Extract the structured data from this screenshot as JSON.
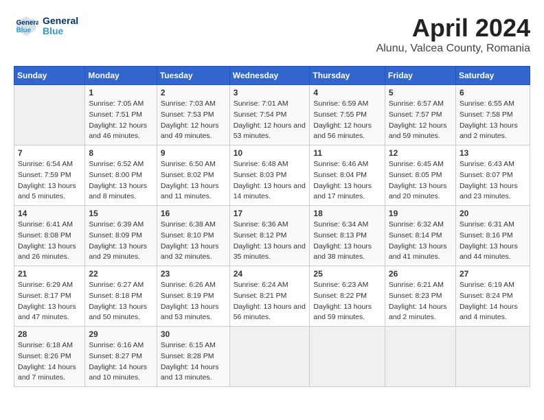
{
  "header": {
    "logo_line1": "General",
    "logo_line2": "Blue",
    "title": "April 2024",
    "subtitle": "Alunu, Valcea County, Romania"
  },
  "calendar": {
    "days_of_week": [
      "Sunday",
      "Monday",
      "Tuesday",
      "Wednesday",
      "Thursday",
      "Friday",
      "Saturday"
    ],
    "weeks": [
      [
        {
          "day": "",
          "empty": true
        },
        {
          "day": "1",
          "sunrise": "Sunrise: 7:05 AM",
          "sunset": "Sunset: 7:51 PM",
          "daylight": "Daylight: 12 hours and 46 minutes."
        },
        {
          "day": "2",
          "sunrise": "Sunrise: 7:03 AM",
          "sunset": "Sunset: 7:53 PM",
          "daylight": "Daylight: 12 hours and 49 minutes."
        },
        {
          "day": "3",
          "sunrise": "Sunrise: 7:01 AM",
          "sunset": "Sunset: 7:54 PM",
          "daylight": "Daylight: 12 hours and 53 minutes."
        },
        {
          "day": "4",
          "sunrise": "Sunrise: 6:59 AM",
          "sunset": "Sunset: 7:55 PM",
          "daylight": "Daylight: 12 hours and 56 minutes."
        },
        {
          "day": "5",
          "sunrise": "Sunrise: 6:57 AM",
          "sunset": "Sunset: 7:57 PM",
          "daylight": "Daylight: 12 hours and 59 minutes."
        },
        {
          "day": "6",
          "sunrise": "Sunrise: 6:55 AM",
          "sunset": "Sunset: 7:58 PM",
          "daylight": "Daylight: 13 hours and 2 minutes."
        }
      ],
      [
        {
          "day": "7",
          "sunrise": "Sunrise: 6:54 AM",
          "sunset": "Sunset: 7:59 PM",
          "daylight": "Daylight: 13 hours and 5 minutes."
        },
        {
          "day": "8",
          "sunrise": "Sunrise: 6:52 AM",
          "sunset": "Sunset: 8:00 PM",
          "daylight": "Daylight: 13 hours and 8 minutes."
        },
        {
          "day": "9",
          "sunrise": "Sunrise: 6:50 AM",
          "sunset": "Sunset: 8:02 PM",
          "daylight": "Daylight: 13 hours and 11 minutes."
        },
        {
          "day": "10",
          "sunrise": "Sunrise: 6:48 AM",
          "sunset": "Sunset: 8:03 PM",
          "daylight": "Daylight: 13 hours and 14 minutes."
        },
        {
          "day": "11",
          "sunrise": "Sunrise: 6:46 AM",
          "sunset": "Sunset: 8:04 PM",
          "daylight": "Daylight: 13 hours and 17 minutes."
        },
        {
          "day": "12",
          "sunrise": "Sunrise: 6:45 AM",
          "sunset": "Sunset: 8:05 PM",
          "daylight": "Daylight: 13 hours and 20 minutes."
        },
        {
          "day": "13",
          "sunrise": "Sunrise: 6:43 AM",
          "sunset": "Sunset: 8:07 PM",
          "daylight": "Daylight: 13 hours and 23 minutes."
        }
      ],
      [
        {
          "day": "14",
          "sunrise": "Sunrise: 6:41 AM",
          "sunset": "Sunset: 8:08 PM",
          "daylight": "Daylight: 13 hours and 26 minutes."
        },
        {
          "day": "15",
          "sunrise": "Sunrise: 6:39 AM",
          "sunset": "Sunset: 8:09 PM",
          "daylight": "Daylight: 13 hours and 29 minutes."
        },
        {
          "day": "16",
          "sunrise": "Sunrise: 6:38 AM",
          "sunset": "Sunset: 8:10 PM",
          "daylight": "Daylight: 13 hours and 32 minutes."
        },
        {
          "day": "17",
          "sunrise": "Sunrise: 6:36 AM",
          "sunset": "Sunset: 8:12 PM",
          "daylight": "Daylight: 13 hours and 35 minutes."
        },
        {
          "day": "18",
          "sunrise": "Sunrise: 6:34 AM",
          "sunset": "Sunset: 8:13 PM",
          "daylight": "Daylight: 13 hours and 38 minutes."
        },
        {
          "day": "19",
          "sunrise": "Sunrise: 6:32 AM",
          "sunset": "Sunset: 8:14 PM",
          "daylight": "Daylight: 13 hours and 41 minutes."
        },
        {
          "day": "20",
          "sunrise": "Sunrise: 6:31 AM",
          "sunset": "Sunset: 8:16 PM",
          "daylight": "Daylight: 13 hours and 44 minutes."
        }
      ],
      [
        {
          "day": "21",
          "sunrise": "Sunrise: 6:29 AM",
          "sunset": "Sunset: 8:17 PM",
          "daylight": "Daylight: 13 hours and 47 minutes."
        },
        {
          "day": "22",
          "sunrise": "Sunrise: 6:27 AM",
          "sunset": "Sunset: 8:18 PM",
          "daylight": "Daylight: 13 hours and 50 minutes."
        },
        {
          "day": "23",
          "sunrise": "Sunrise: 6:26 AM",
          "sunset": "Sunset: 8:19 PM",
          "daylight": "Daylight: 13 hours and 53 minutes."
        },
        {
          "day": "24",
          "sunrise": "Sunrise: 6:24 AM",
          "sunset": "Sunset: 8:21 PM",
          "daylight": "Daylight: 13 hours and 56 minutes."
        },
        {
          "day": "25",
          "sunrise": "Sunrise: 6:23 AM",
          "sunset": "Sunset: 8:22 PM",
          "daylight": "Daylight: 13 hours and 59 minutes."
        },
        {
          "day": "26",
          "sunrise": "Sunrise: 6:21 AM",
          "sunset": "Sunset: 8:23 PM",
          "daylight": "Daylight: 14 hours and 2 minutes."
        },
        {
          "day": "27",
          "sunrise": "Sunrise: 6:19 AM",
          "sunset": "Sunset: 8:24 PM",
          "daylight": "Daylight: 14 hours and 4 minutes."
        }
      ],
      [
        {
          "day": "28",
          "sunrise": "Sunrise: 6:18 AM",
          "sunset": "Sunset: 8:26 PM",
          "daylight": "Daylight: 14 hours and 7 minutes."
        },
        {
          "day": "29",
          "sunrise": "Sunrise: 6:16 AM",
          "sunset": "Sunset: 8:27 PM",
          "daylight": "Daylight: 14 hours and 10 minutes."
        },
        {
          "day": "30",
          "sunrise": "Sunrise: 6:15 AM",
          "sunset": "Sunset: 8:28 PM",
          "daylight": "Daylight: 14 hours and 13 minutes."
        },
        {
          "day": "",
          "empty": true
        },
        {
          "day": "",
          "empty": true
        },
        {
          "day": "",
          "empty": true
        },
        {
          "day": "",
          "empty": true
        }
      ]
    ]
  }
}
